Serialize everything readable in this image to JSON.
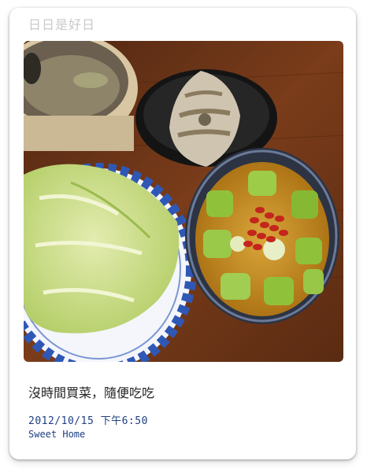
{
  "app": {
    "title": "日日是好日"
  },
  "post": {
    "caption": "沒時間買菜，隨便吃吃",
    "timestamp": "2012/10/15 下午6:50",
    "location": "Sweet Home"
  },
  "photo": {
    "subject_icon": "food-photo",
    "colors": {
      "table": "#6a3418",
      "plate_border": "#2f58b6",
      "cabbage": "#c8dc8a",
      "soup": "#c88f22",
      "gourd": "#8fc23a",
      "goji": "#c3261c",
      "fish": "#cfc4b0",
      "dish_dark": "#1b1b1b",
      "bowl_rim": "#4a5a78"
    }
  }
}
